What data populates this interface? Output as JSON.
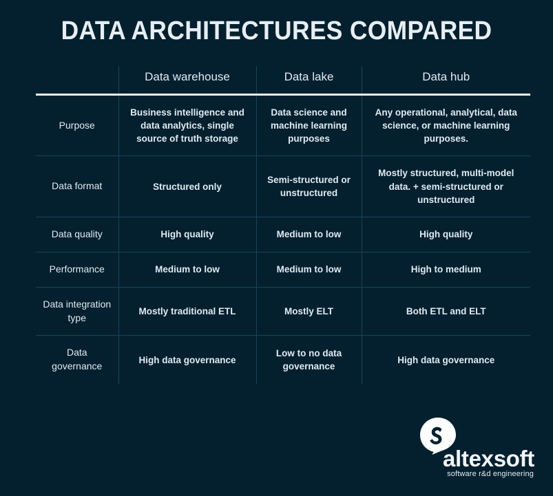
{
  "page": {
    "title": "DATA ARCHITECTURES COMPARED",
    "background_color": "#04202f",
    "text_color": "#dfeaf1",
    "rule_color": "#1d4257",
    "header_rule_color": "#eef4f8"
  },
  "table": {
    "corner_label": "",
    "columns": [
      {
        "key": "attribute",
        "label": ""
      },
      {
        "key": "data_warehouse",
        "label": "Data warehouse"
      },
      {
        "key": "data_lake",
        "label": "Data lake"
      },
      {
        "key": "data_hub",
        "label": "Data hub"
      }
    ],
    "rows": [
      {
        "label": "Purpose",
        "data_warehouse": "Business intelligence and data analytics, single source of truth storage",
        "data_lake": "Data science and machine learning purposes",
        "data_hub": "Any operational, analytical, data science, or machine learning purposes."
      },
      {
        "label": "Data format",
        "data_warehouse": "Structured only",
        "data_lake": "Semi-structured or unstructured",
        "data_hub": "Mostly structured, multi-model data. + semi-structured or unstructured"
      },
      {
        "label": "Data quality",
        "data_warehouse": "High quality",
        "data_lake": "Medium to low",
        "data_hub": "High quality"
      },
      {
        "label": "Performance",
        "data_warehouse": "Medium to low",
        "data_lake": "Medium to low",
        "data_hub": "High to medium"
      },
      {
        "label": "Data integration type",
        "data_warehouse": "Mostly traditional ETL",
        "data_lake": "Mostly ELT",
        "data_hub": "Both ETL and ELT"
      },
      {
        "label": "Data governance",
        "data_warehouse": "High data governance",
        "data_lake": "Low to no data governance",
        "data_hub": "High data governance"
      }
    ]
  },
  "logo": {
    "mark_name": "altexsoft-logo-mark",
    "wordmark": "altexsoft",
    "tagline": "software r&d engineering",
    "mark_color": "#ffffff",
    "mark_inner_color": "#04202f"
  }
}
